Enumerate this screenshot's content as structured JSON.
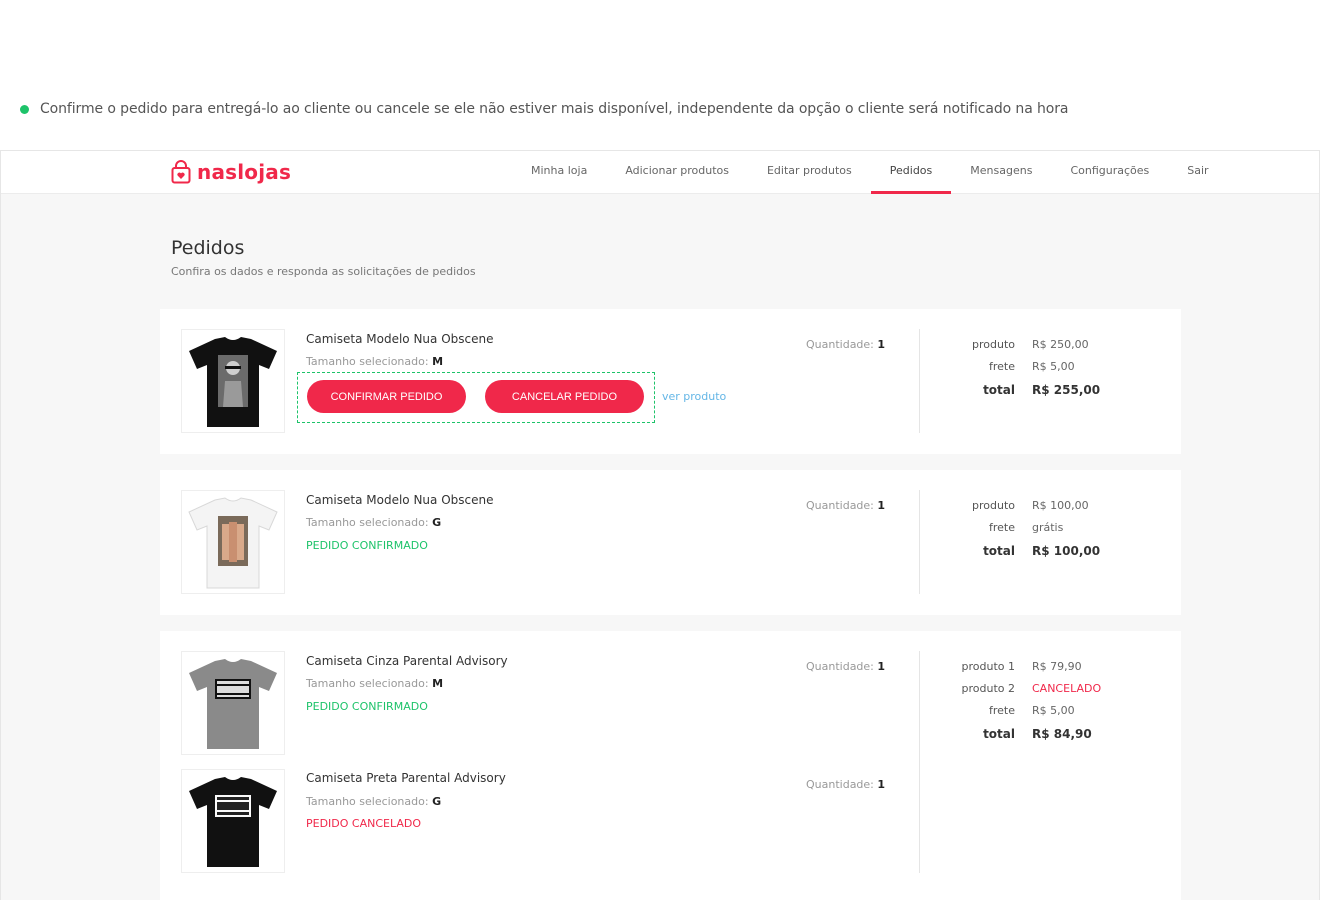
{
  "note": "Confirme o pedido para entregá-lo ao cliente ou cancele se ele não estiver mais disponível, independente da opção o cliente será notificado na hora",
  "brand": {
    "name": "naslojas",
    "accent": "#f0284a",
    "success": "#1ec36a",
    "link": "#64b6e6"
  },
  "nav": [
    "Minha loja",
    "Adicionar produtos",
    "Editar produtos",
    "Pedidos",
    "Mensagens",
    "Configurações",
    "Sair"
  ],
  "nav_active": "Pedidos",
  "page": {
    "title": "Pedidos",
    "subtitle": "Confira os dados e responda as solicitações de pedidos"
  },
  "labels": {
    "quantity": "Quantidade:",
    "size": "Tamanho selecionado:",
    "confirm": "CONFIRMAR PEDIDO",
    "cancel": "CANCELAR PEDIDO",
    "view": "ver produto",
    "total": "total"
  },
  "orders": [
    {
      "items": [
        {
          "name": "Camiseta Modelo Nua Obscene",
          "size": "M",
          "qty": "1",
          "shirt": "black"
        }
      ],
      "prices": [
        {
          "label": "produto",
          "value": "R$ 250,00"
        },
        {
          "label": "frete",
          "value": "R$ 5,00"
        }
      ],
      "total": "R$ 255,00"
    },
    {
      "items": [
        {
          "name": "Camiseta Modelo Nua Obscene",
          "size": "G",
          "qty": "1",
          "status": "PEDIDO CONFIRMADO",
          "shirt": "white"
        }
      ],
      "prices": [
        {
          "label": "produto",
          "value": "R$ 100,00"
        },
        {
          "label": "frete",
          "value": "grátis"
        }
      ],
      "total": "R$ 100,00"
    },
    {
      "items": [
        {
          "name": "Camiseta Cinza Parental Advisory",
          "size": "M",
          "qty": "1",
          "status": "PEDIDO CONFIRMADO",
          "shirt": "gray"
        },
        {
          "name": "Camiseta Preta Parental Advisory",
          "size": "G",
          "qty": "1",
          "status": "PEDIDO CANCELADO",
          "shirt": "black"
        }
      ],
      "prices": [
        {
          "label": "produto 1",
          "value": "R$ 79,90"
        },
        {
          "label": "produto 2",
          "value": "CANCELADO"
        },
        {
          "label": "frete",
          "value": "R$ 5,00"
        }
      ],
      "total": "R$ 84,90"
    }
  ]
}
